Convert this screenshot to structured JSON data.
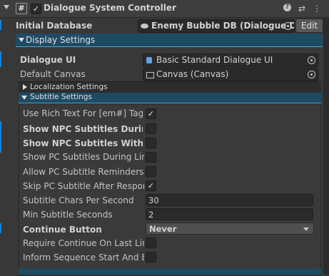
{
  "header": {
    "component_title": "Dialogue System Controller",
    "enabled_check": "✓",
    "hash_glyph": "#",
    "help_glyph": "?",
    "settings_glyph": "⇄",
    "menu_glyph": "⋮"
  },
  "initial_database": {
    "label": "Initial Database",
    "value": "Enemy Bubble DB (Dialogue Dat",
    "edit_label": "Edit"
  },
  "display_settings": {
    "title": "Display Settings",
    "dialogue_ui": {
      "label": "Dialogue UI",
      "value": "Basic Standard Dialogue UI"
    },
    "default_canvas": {
      "label": "Default Canvas",
      "value": "Canvas (Canvas)"
    },
    "localization_title": "Localization Settings",
    "subtitle_title": "Subtitle Settings"
  },
  "subtitle_settings": {
    "rows": [
      {
        "label": "Use Rich Text For [em#] Tags",
        "checked": "✓"
      },
      {
        "label": "Show NPC Subtitles During L",
        "checked": ""
      },
      {
        "label": "Show NPC Subtitles With Res",
        "checked": ""
      },
      {
        "label": "Show PC Subtitles During Line",
        "checked": ""
      },
      {
        "label": "Allow PC Subtitle Reminders",
        "checked": ""
      },
      {
        "label": "Skip PC Subtitle After Respons",
        "checked": "✓"
      }
    ],
    "chars_per_second": {
      "label": "Subtitle Chars Per Second",
      "value": "30"
    },
    "min_seconds": {
      "label": "Min Subtitle Seconds",
      "value": "2"
    },
    "continue_button": {
      "label": "Continue Button",
      "value": "Never"
    },
    "require_continue": {
      "label": "Require Continue On Last Line",
      "checked": ""
    },
    "inform_sequence": {
      "label": "Inform Sequence Start And End",
      "checked": ""
    }
  },
  "colors": {
    "accent_blue": "#0f83d6",
    "section_bar": "#1f4a63",
    "background": "#383838"
  }
}
